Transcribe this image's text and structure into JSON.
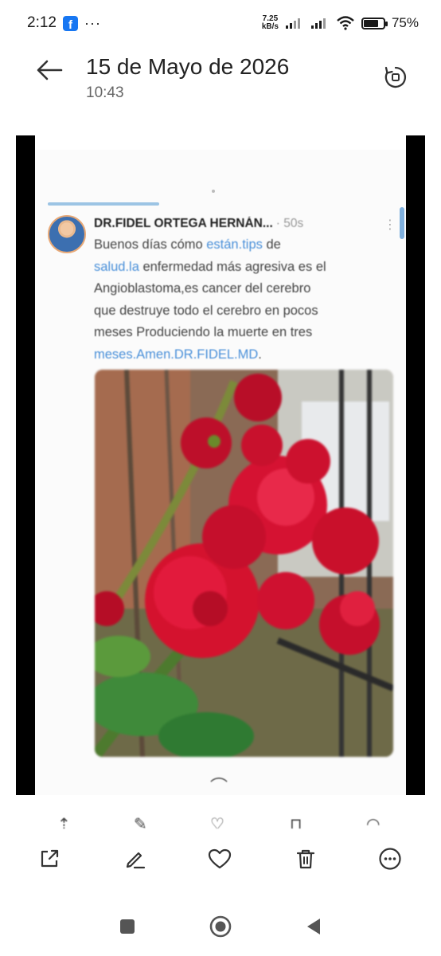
{
  "status_bar": {
    "time": "2:12",
    "notification_icons": [
      "facebook-icon",
      "more-dots"
    ],
    "dots": "···",
    "network_speed_value": "7.25",
    "network_speed_unit": "kB/s",
    "battery_percent": "75%",
    "battery_level": 0.75
  },
  "header": {
    "title": "15 de Mayo de 2026",
    "subtitle": "10:43"
  },
  "post": {
    "author": "DR.FIDEL ORTEGA HERNÁN...",
    "time_ago": "· 50s",
    "more": "⋮",
    "lines": [
      [
        "Buenos días cómo ",
        "están.tips",
        " de"
      ],
      [
        "salud.la",
        " enfermedad más agresiva es el",
        ""
      ],
      [
        "Angioblastoma,es cancer del cerebro",
        "",
        ""
      ],
      [
        "que destruye todo el cerebro en pocos",
        "",
        ""
      ],
      [
        "meses Produciendo la muerte en tres",
        "",
        ""
      ],
      [
        "meses.Amen.DR.FIDEL.MD",
        ".",
        ""
      ]
    ]
  },
  "viewer": {
    "swipe_hint": "⌒",
    "colors": {
      "bars": "#000000",
      "link": "#4a90d9",
      "rose": "#d4122e"
    }
  },
  "actions": [
    {
      "name": "share-button",
      "icon": "share-icon"
    },
    {
      "name": "edit-button",
      "icon": "pencil-icon"
    },
    {
      "name": "favorite-button",
      "icon": "heart-icon"
    },
    {
      "name": "delete-button",
      "icon": "trash-icon"
    },
    {
      "name": "more-button",
      "icon": "more-horizontal-icon"
    }
  ],
  "nav": [
    "recents-square-icon",
    "home-circle-icon",
    "back-triangle-icon"
  ]
}
